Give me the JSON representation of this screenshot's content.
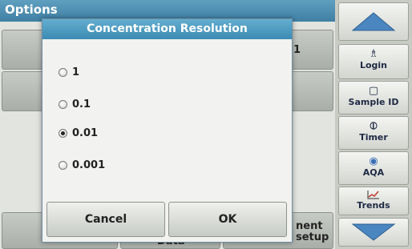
{
  "screen": {
    "title": "Options",
    "background_buttons": {
      "row1_partial": "1",
      "bottom_right_partial": "nent\nsetup",
      "bottom_mid_partial": "Data"
    }
  },
  "sidebar": {
    "items": [
      {
        "label": "",
        "icon": "arrow-up-icon"
      },
      {
        "label": "Login",
        "icon": "person-icon"
      },
      {
        "label": "Sample ID",
        "icon": "sample-vial-icon"
      },
      {
        "label": "Timer",
        "icon": "timer-icon"
      },
      {
        "label": "AQA",
        "icon": "aqa-icon"
      },
      {
        "label": "Trends",
        "icon": "trends-chart-icon"
      },
      {
        "label": "",
        "icon": "arrow-down-icon"
      }
    ]
  },
  "dialog": {
    "title": "Concentration Resolution",
    "options": [
      {
        "label": "1",
        "selected": false
      },
      {
        "label": "0.1",
        "selected": false
      },
      {
        "label": "0.01",
        "selected": true
      },
      {
        "label": "0.001",
        "selected": false
      }
    ],
    "cancel_label": "Cancel",
    "ok_label": "OK"
  },
  "colors": {
    "title_bar": "#3f7fa3",
    "dialog_header": "#4f9dc2",
    "arrow": "#4a86c0"
  }
}
